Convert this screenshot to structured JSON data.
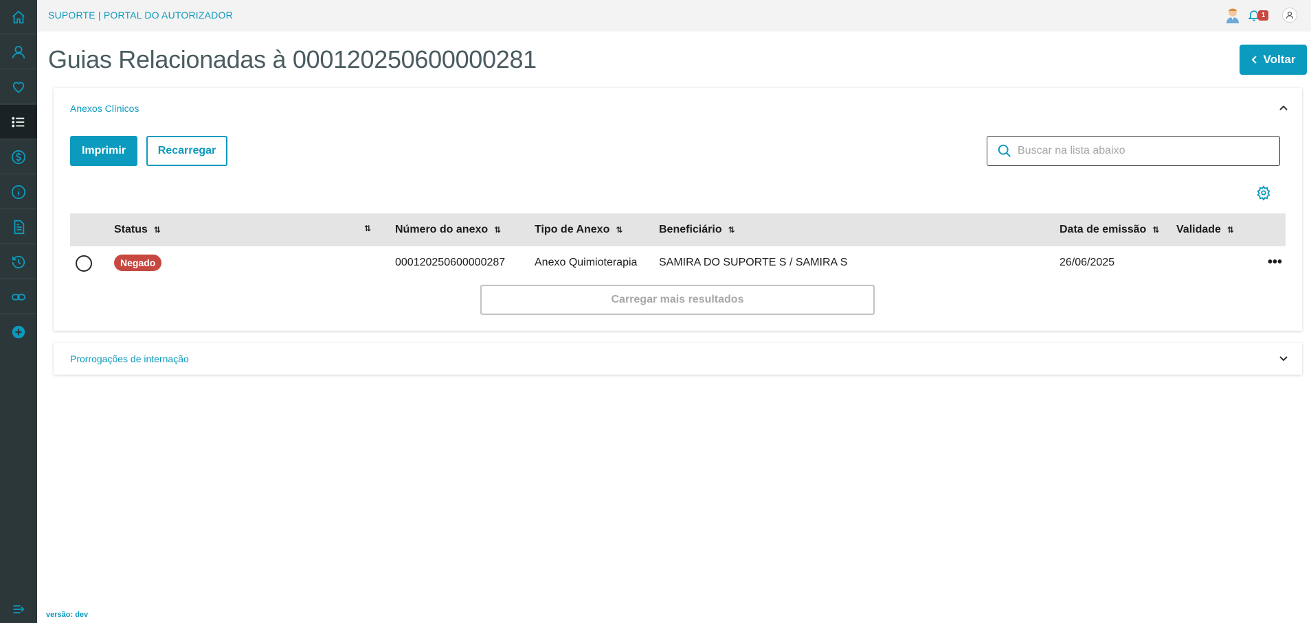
{
  "header": {
    "app_title": "SUPORTE | PORTAL DO AUTORIZADOR",
    "notification_count": "1"
  },
  "sidebar": {
    "items": [
      "home-icon",
      "user-icon",
      "heart-icon",
      "list-icon",
      "dollar-icon",
      "info-icon",
      "document-icon",
      "history-icon",
      "link-icon",
      "add-icon"
    ],
    "active": "list-icon",
    "version": "versão: dev"
  },
  "page": {
    "title": "Guias Relacionadas à 000120250600000281",
    "back_label": "Voltar"
  },
  "panel_anexos": {
    "title": "Anexos Clínicos",
    "print_label": "Imprimir",
    "reload_label": "Recarregar",
    "search_placeholder": "Buscar na lista abaixo",
    "columns": {
      "status": "Status",
      "numero": "Número do anexo",
      "tipo": "Tipo de Anexo",
      "beneficiario": "Beneficiário",
      "data": "Data de emissão",
      "validade": "Validade"
    },
    "rows": [
      {
        "status": "Negado",
        "numero": "000120250600000287",
        "tipo": "Anexo Quimioterapia",
        "beneficiario": "SAMIRA DO SUPORTE S / SAMIRA S",
        "data": "26/06/2025",
        "validade": ""
      }
    ],
    "load_more_label": "Carregar mais resultados"
  },
  "panel_prorrogacoes": {
    "title": "Prorrogações de internação"
  },
  "colors": {
    "accent": "#0c9abe",
    "sidebar": "#2c3739",
    "negado": "#c64840"
  }
}
